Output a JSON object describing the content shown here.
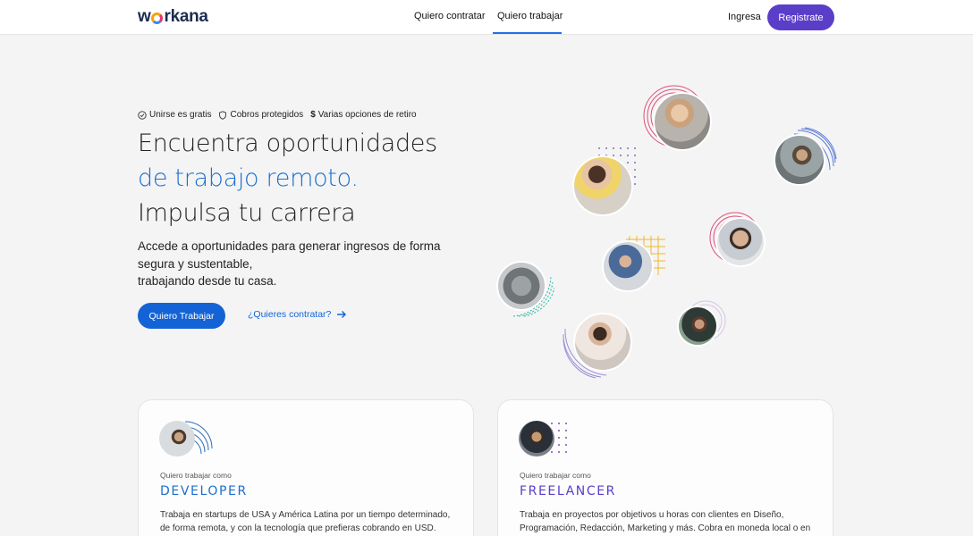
{
  "header": {
    "logo": "workana",
    "nav": [
      "Quiero contratar",
      "Quiero trabajar"
    ],
    "login": "Ingresa",
    "register": "Registrate"
  },
  "hero": {
    "benefits": [
      "Unirse es gratis",
      "Cobros protegidos",
      "Varias opciones de retiro"
    ],
    "title_line1": "Encuentra oportunidades",
    "title_line2": "de trabajo remoto.",
    "title_line3": "Impulsa tu carrera",
    "subtitle_line1": "Accede a oportunidades para generar ingresos de forma",
    "subtitle_line2": "segura y sustentable,",
    "subtitle_line3": "trabajando desde tu casa.",
    "cta_primary": "Quiero Trabajar",
    "cta_secondary": "¿Quieres contratar?"
  },
  "cards": [
    {
      "kicker": "Quiero trabajar como",
      "role": "DEVELOPER",
      "role_color": "#1b6fcf",
      "desc_line1": "Trabaja en startups de USA y América Latina por un tiempo determinado,",
      "desc_line2": "de forma remota, y con la tecnología que prefieras cobrando en USD."
    },
    {
      "kicker": "Quiero trabajar como",
      "role": "FREELANCER",
      "role_color": "#5a3ec8",
      "desc_line1": "Trabaja en proyectos por objetivos u horas con clientes en Diseño,",
      "desc_line2": "Programación, Redacción, Marketing y más. Cobra en moneda local o en"
    }
  ],
  "colors": {
    "primary_blue": "#1463d6",
    "register_purple": "#5a3ec8",
    "background": "#f4f4f4"
  }
}
